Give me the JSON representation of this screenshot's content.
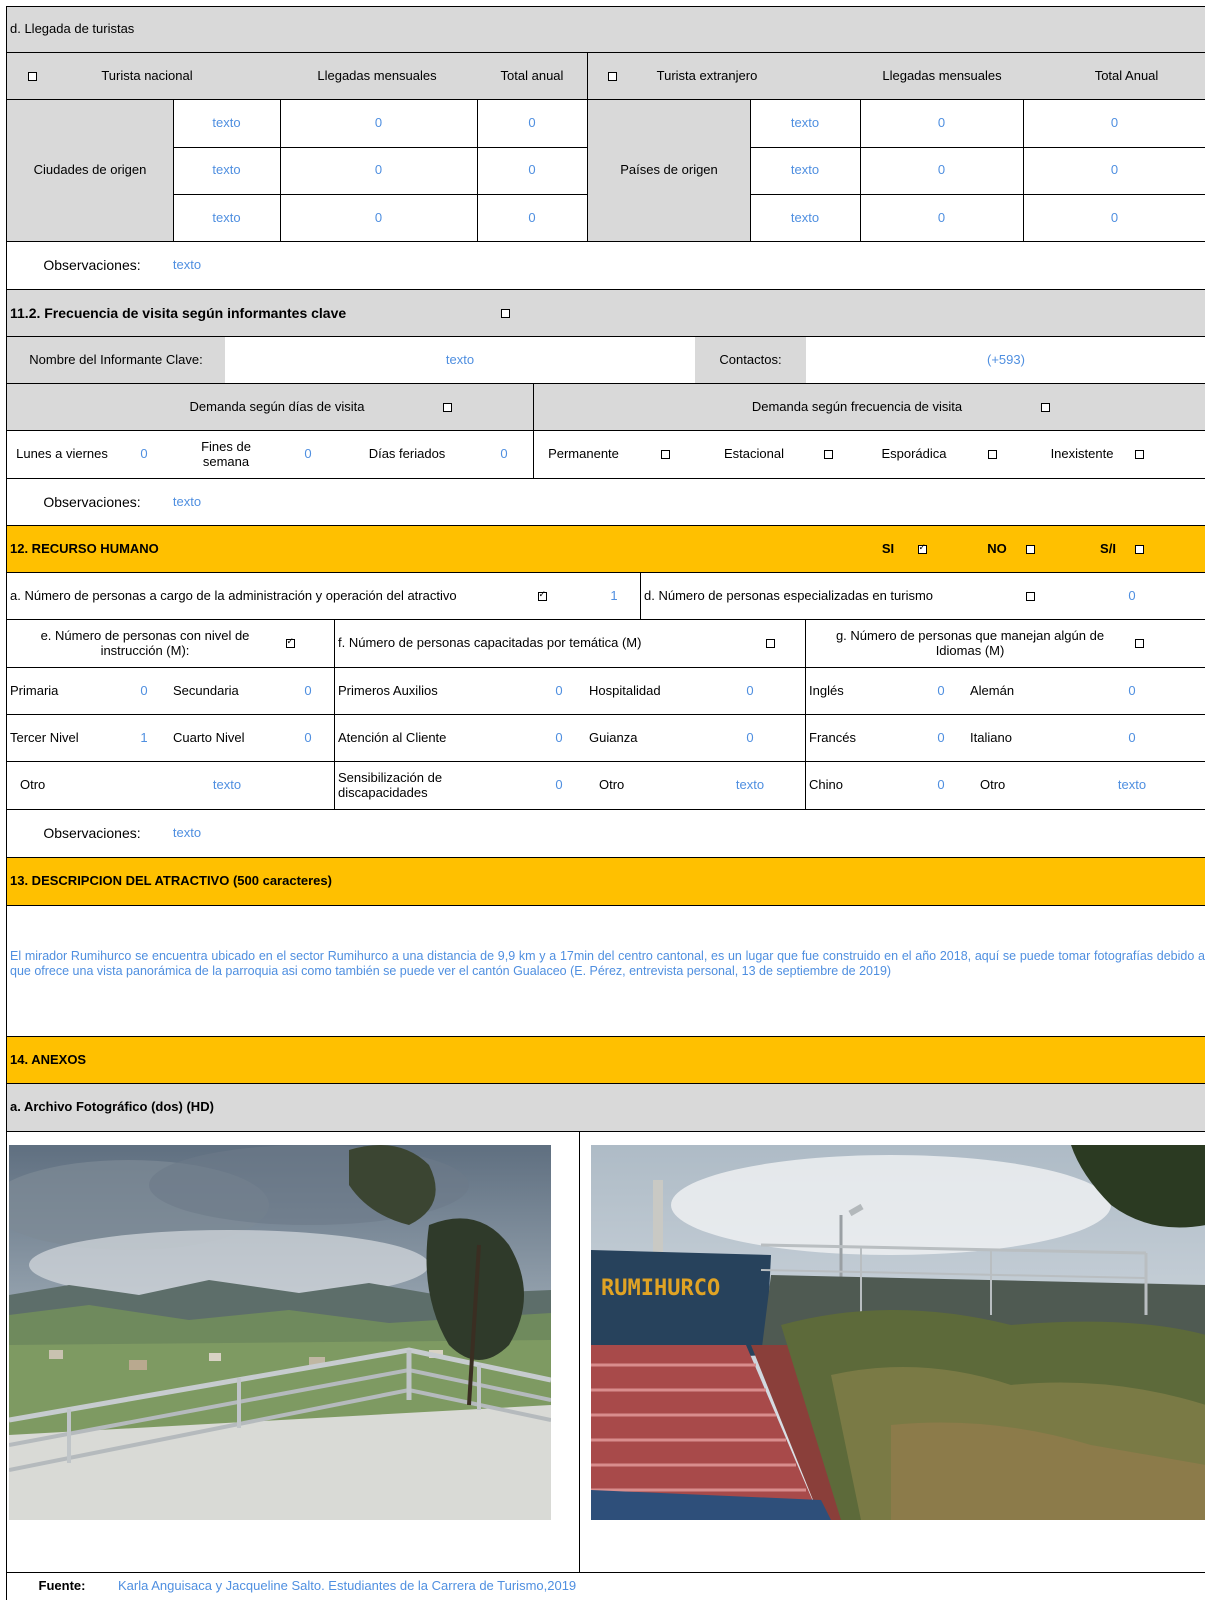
{
  "llegada": {
    "title": "d. Llegada de turistas",
    "nacional": "Turista nacional",
    "llegadas_mensuales": "Llegadas mensuales",
    "total_anual": "Total anual",
    "extranjero": "Turista extranjero",
    "llegadas_mensuales_ext": "Llegadas mensuales",
    "total_anual_ext": "Total Anual",
    "ciudades": "Ciudades de origen",
    "paises": "Países de origen",
    "rows": [
      {
        "ciudad": "texto",
        "mensual": "0",
        "anual": "0",
        "pais": "texto",
        "mensual_ext": "0",
        "anual_ext": "0"
      },
      {
        "ciudad": "texto",
        "mensual": "0",
        "anual": "0",
        "pais": "texto",
        "mensual_ext": "0",
        "anual_ext": "0"
      },
      {
        "ciudad": "texto",
        "mensual": "0",
        "anual": "0",
        "pais": "texto",
        "mensual_ext": "0",
        "anual_ext": "0"
      }
    ],
    "obs_label": "Observaciones:",
    "obs_value": "texto"
  },
  "frecuencia": {
    "title": "11.2. Frecuencia de visita según informantes clave",
    "informante_label": "Nombre del Informante Clave:",
    "informante_value": "texto",
    "contactos_label": "Contactos:",
    "contactos_value": "(+593)",
    "dias_header": "Demanda según  días de visita",
    "frec_header": "Demanda según frecuencia de visita",
    "lunes_label": "Lunes a viernes",
    "lunes_value": "0",
    "fines_label": "Fines de semana",
    "fines_value": "0",
    "feriados_label": "Días feriados",
    "feriados_value": "0",
    "permanente": "Permanente",
    "estacional": "Estacional",
    "esporadica": "Esporádica",
    "inexistente": "Inexistente",
    "obs_label": "Observaciones:",
    "obs_value": "texto"
  },
  "recurso": {
    "title": "12. RECURSO HUMANO",
    "si": "SI",
    "no": "NO",
    "si_flag": "S/I",
    "a_label": "a. Número de personas a cargo de la administración y operación del atractivo",
    "a_value": "1",
    "d_label": "d. Número de personas especializadas en turismo",
    "d_value": "0",
    "e_label": "e. Número de personas con nivel de instrucción (M):",
    "f_label": "f. Número de personas capacitadas por temática (M)",
    "g_label": "g. Número de personas que manejan algún de Idiomas (M)",
    "primaria": "Primaria",
    "primaria_v": "0",
    "secundaria": "Secundaria",
    "secundaria_v": "0",
    "tercer": "Tercer Nivel",
    "tercer_v": "1",
    "cuarto": "Cuarto Nivel",
    "cuarto_v": "0",
    "otro_e": "Otro",
    "otro_e_v": "texto",
    "auxilios": "Primeros Auxilios",
    "auxilios_v": "0",
    "hospitalidad": "Hospitalidad",
    "hospitalidad_v": "0",
    "atencion": "Atención al Cliente",
    "atencion_v": "0",
    "guianza": "Guianza",
    "guianza_v": "0",
    "sensibilizacion": "Sensibilización de discapacidades",
    "sensibilizacion_v": "0",
    "otro_f": "Otro",
    "otro_f_v": "texto",
    "ingles": "Inglés",
    "ingles_v": "0",
    "aleman": "Alemán",
    "aleman_v": "0",
    "frances": "Francés",
    "frances_v": "0",
    "italiano": "Italiano",
    "italiano_v": "0",
    "chino": "Chino",
    "chino_v": "0",
    "otro_g": "Otro",
    "otro_g_v": "texto",
    "obs_label": "Observaciones:",
    "obs_value": "texto"
  },
  "descripcion": {
    "title": "13. DESCRIPCION DEL ATRACTIVO (500 caracteres)",
    "text": "El mirador Rumihurco se encuentra ubicado en el sector Rumihurco a una distancia de 9,9 km y a 17min del centro cantonal, es un lugar que fue construido en el año 2018, aquí se puede tomar fotografías debido a que ofrece una vista panorámica de la parroquia asi como también se puede ver el cantón Gualaceo (E. Pérez, entrevista personal,  13 de septiembre de 2019)"
  },
  "anexos": {
    "title": "14. ANEXOS",
    "archivo": "a. Archivo Fotográfico (dos) (HD)",
    "sign_text": "RUMIHURCO",
    "fuente_label": "Fuente:",
    "fuente_value": "Karla Anguisaca y Jacqueline Salto. Estudiantes de la Carrera de Turismo,2019"
  }
}
